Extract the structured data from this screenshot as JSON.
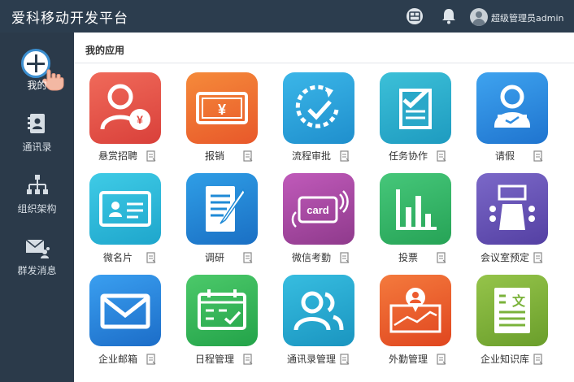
{
  "header": {
    "title": "爱科移动开发平台",
    "user_name": "超级管理员admin"
  },
  "sidebar": {
    "items": [
      {
        "label": "我的"
      },
      {
        "label": "通讯录"
      },
      {
        "label": "组织架构"
      },
      {
        "label": "群发消息"
      }
    ]
  },
  "main": {
    "section_title": "我的应用",
    "apps": [
      {
        "label": "悬赏招聘",
        "icon": "recruit-icon",
        "color": "#e8554a"
      },
      {
        "label": "报销",
        "icon": "reimburse-icon",
        "color": "#ee6a2a"
      },
      {
        "label": "流程审批",
        "icon": "approval-icon",
        "color": "#2ba0d9"
      },
      {
        "label": "任务协作",
        "icon": "task-icon",
        "color": "#2aa8c9"
      },
      {
        "label": "请假",
        "icon": "leave-icon",
        "color": "#2d8be0"
      },
      {
        "label": "微名片",
        "icon": "card-icon",
        "color": "#29b7d9"
      },
      {
        "label": "调研",
        "icon": "survey-icon",
        "color": "#1f8ad6"
      },
      {
        "label": "微信考勤",
        "icon": "attendance-icon",
        "color": "#a94ba1"
      },
      {
        "label": "投票",
        "icon": "vote-icon",
        "color": "#34b86a"
      },
      {
        "label": "会议室预定",
        "icon": "meeting-room-icon",
        "color": "#6a5ab7"
      },
      {
        "label": "企业邮箱",
        "icon": "mail-icon",
        "color": "#2b8ad8"
      },
      {
        "label": "日程管理",
        "icon": "schedule-icon",
        "color": "#39b65a"
      },
      {
        "label": "通讯录管理",
        "icon": "contacts-icon",
        "color": "#1fa3c9"
      },
      {
        "label": "外勤管理",
        "icon": "field-work-icon",
        "color": "#ec5b2f"
      },
      {
        "label": "企业知识库",
        "icon": "knowledge-icon",
        "color": "#7ab23a"
      }
    ]
  }
}
